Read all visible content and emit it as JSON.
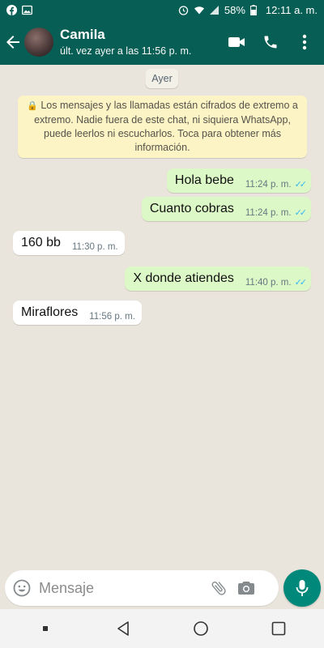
{
  "status_bar": {
    "battery": "58%",
    "time": "12:11 a. m."
  },
  "header": {
    "contact_name": "Camila",
    "last_seen": "últ. vez ayer a las 11:56 p. m."
  },
  "chat": {
    "date_label": "Ayer",
    "encryption_notice": "Los mensajes y las llamadas están cifrados de extremo a extremo. Nadie fuera de este chat, ni siquiera WhatsApp, puede leerlos ni escucharlos. Toca para obtener más información.",
    "messages": [
      {
        "direction": "out",
        "text": "Hola bebe",
        "time": "11:24 p. m."
      },
      {
        "direction": "out",
        "text": "Cuanto cobras",
        "time": "11:24 p. m."
      },
      {
        "direction": "in",
        "text": "160 bb",
        "time": "11:30 p. m."
      },
      {
        "direction": "out",
        "text": "X donde atiendes",
        "time": "11:40 p. m."
      },
      {
        "direction": "in",
        "text": "Miraflores",
        "time": "11:56 p. m."
      }
    ]
  },
  "composer": {
    "placeholder": "Mensaje"
  },
  "colors": {
    "header": "#075e54",
    "outgoing_bubble": "#dcf8c6",
    "incoming_bubble": "#ffffff",
    "read_ticks": "#34b7f1",
    "mic_button": "#00897b",
    "notice_bg": "#fdf4c5"
  },
  "icons": [
    "facebook-icon",
    "image-icon",
    "alarm-icon",
    "wifi-icon",
    "signal-icon",
    "battery-icon",
    "back-arrow-icon",
    "video-call-icon",
    "phone-icon",
    "more-options-icon",
    "lock-icon",
    "double-check-icon",
    "emoji-icon",
    "attach-icon",
    "camera-icon",
    "mic-icon",
    "nav-recents-dot-icon",
    "nav-back-icon",
    "nav-home-icon",
    "nav-overview-icon"
  ]
}
